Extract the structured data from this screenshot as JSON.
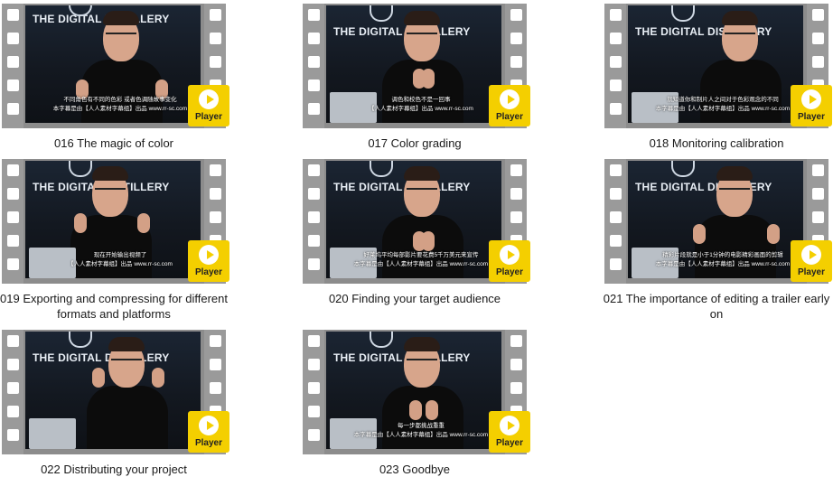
{
  "thumbnail": {
    "logo_text": "THE DIGITAL DISTILLERY",
    "player_label": "Player"
  },
  "items": [
    {
      "title": "016 The magic of color",
      "sub1": "不同角色有不同的色彩 或者色调随故事变化",
      "sub2": "本字幕是由【人人素材字幕组】出品 www.rr-sc.com"
    },
    {
      "title": "017 Color grading",
      "sub1": "调色和校色不是一回事",
      "sub2": "【人人素材字幕组】出品 www.rr-sc.com"
    },
    {
      "title": "018 Monitoring calibration",
      "sub1": "就知道你和制片人之间对于色彩观念的不同",
      "sub2": "本字幕是由【人人素材字幕组】出品 www.rr-sc.com"
    },
    {
      "title": "019 Exporting and compressing for different formats and platforms",
      "sub1": "现在开始输出视频了",
      "sub2": "【人人素材字幕组】出品 www.rr-sc.com"
    },
    {
      "title": "020 Finding your target audience",
      "sub1": "好莱坞平均每部影片要花费5千万美元来宣传",
      "sub2": "本字幕是由【人人素材字幕组】出品 www.rr-sc.com"
    },
    {
      "title": "021 The importance of editing a trailer early on",
      "sub1": "精彩片段就是小于1分钟的电影精彩画面的剪辑",
      "sub2": "本字幕是由【人人素材字幕组】出品 www.rr-sc.com"
    },
    {
      "title": "022 Distributing your project",
      "sub1": "",
      "sub2": ""
    },
    {
      "title": "023 Goodbye",
      "sub1": "每一步都挑战重重",
      "sub2": "本字幕是由【人人素材字幕组】出品 www.rr-sc.com"
    }
  ]
}
